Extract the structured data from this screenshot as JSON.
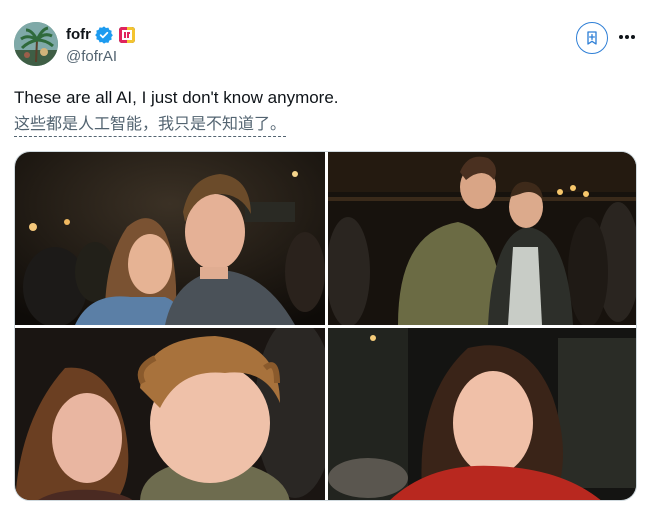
{
  "post": {
    "author": {
      "display_name": "fofr",
      "handle": "@fofrAI",
      "verified": true,
      "verified_color": "#1d9bf0",
      "avatar_icon": "palm-tree-painting-avatar"
    },
    "actions": {
      "bookmark_icon": "bookmark-plus-icon",
      "more_icon": "more-dots-icon"
    },
    "text": "These are all AI, I just don't know anymore.",
    "translation": "这些都是人工智能，我只是不知道了。",
    "media": {
      "count": 4,
      "photos": [
        {
          "description_icon": "photo-1"
        },
        {
          "description_icon": "photo-2"
        },
        {
          "description_icon": "photo-3"
        },
        {
          "description_icon": "photo-4"
        }
      ]
    }
  },
  "colors": {
    "accent": "#1d9bf0",
    "text_primary": "#0f1419",
    "text_secondary": "#536471",
    "border": "#cfd9de"
  }
}
